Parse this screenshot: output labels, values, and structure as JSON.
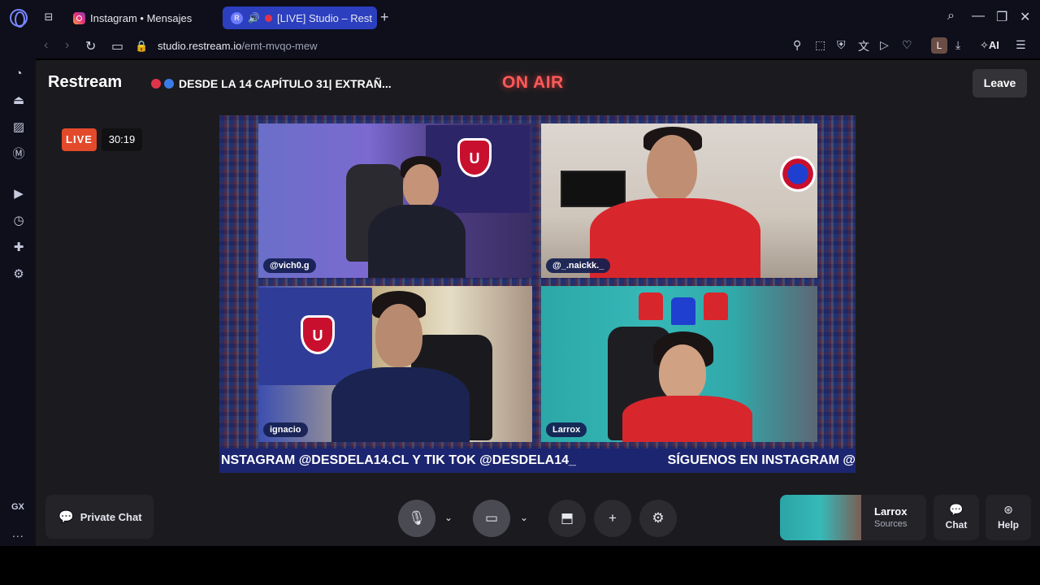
{
  "browser": {
    "tabs": [
      {
        "label": "Instagram • Mensajes",
        "active": false
      },
      {
        "label": "[LIVE] Studio – Rest",
        "active": true
      }
    ],
    "new_tab": "+",
    "url_host": "studio.restream.io",
    "url_path": "/emt-mvqo-mew",
    "profile_initial": "L",
    "ai_label": "AI",
    "gx_label": "GX",
    "more_label": "..."
  },
  "header": {
    "brand": "Restream",
    "stream_title": "DESDE LA 14 CAPÍTULO 31| EXTRAÑ...",
    "on_air": "ON AIR",
    "leave_label": "Leave"
  },
  "status": {
    "live_label": "LIVE",
    "timer": "30:19"
  },
  "participants": [
    {
      "name": "@vich0.g"
    },
    {
      "name": "@_.naickk._"
    },
    {
      "name": "ignacio"
    },
    {
      "name": "Larrox"
    }
  ],
  "ticker": {
    "left_text": "NSTAGRAM @DESDELA14.CL Y TIK TOK @DESDELA14_",
    "right_text": "SÍGUENOS EN INSTAGRAM @"
  },
  "controls": {
    "private_chat": "Private Chat",
    "preview_name": "Larrox",
    "preview_sub": "Sources",
    "chat_label": "Chat",
    "help_label": "Help"
  },
  "colors": {
    "accent_tab": "#2b3fbf",
    "live_badge": "#e34a2b",
    "on_air": "#ff5a5a",
    "ticker_bg": "#1c2570"
  }
}
